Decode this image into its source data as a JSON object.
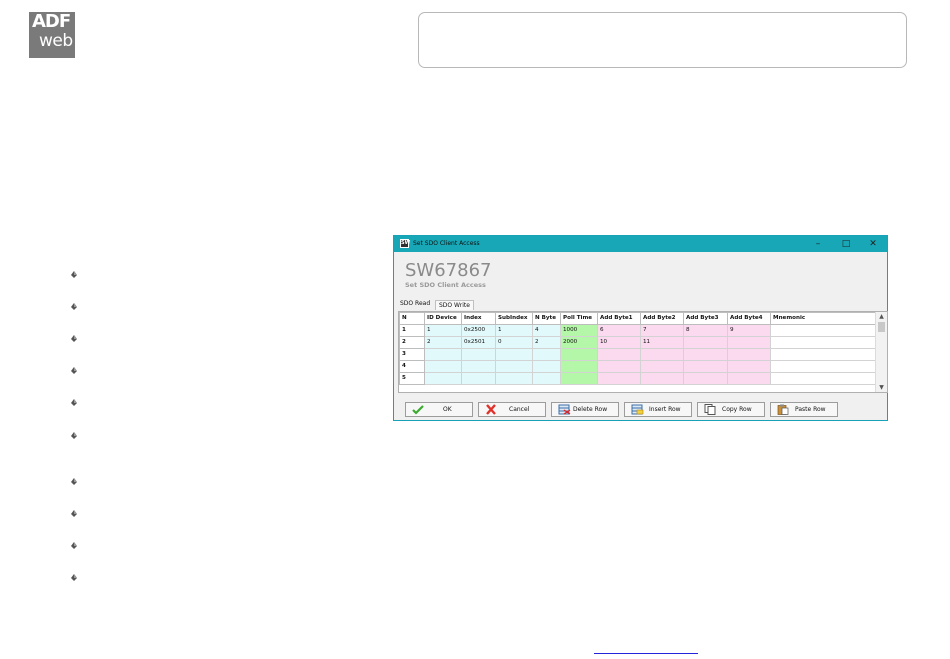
{
  "logo": {
    "line1": "ADF",
    "line2": "web"
  },
  "dialog": {
    "window_title": "Set SDO Client Access",
    "app_icon_text": "SW",
    "window_buttons": {
      "minimize": "–",
      "maximize": "□",
      "close": "✕"
    },
    "big_title": "SW67867",
    "subtitle": "Set SDO Client Access",
    "tabs": [
      {
        "label": "SDO Read",
        "active": true
      },
      {
        "label": "SDO Write",
        "active": false
      }
    ],
    "grid": {
      "columns": [
        "N",
        "ID Device",
        "Index",
        "SubIndex",
        "N Byte",
        "Poll Time",
        "Add Byte1",
        "Add Byte2",
        "Add Byte3",
        "Add Byte4",
        "Mnemonic"
      ],
      "rows": [
        [
          "1",
          "1",
          "0x2500",
          "1",
          "4",
          "1000",
          "6",
          "7",
          "8",
          "9",
          ""
        ],
        [
          "2",
          "2",
          "0x2501",
          "0",
          "2",
          "2000",
          "10",
          "11",
          "",
          "",
          ""
        ],
        [
          "3",
          "",
          "",
          "",
          "",
          "",
          "",
          "",
          "",
          "",
          ""
        ],
        [
          "4",
          "",
          "",
          "",
          "",
          "",
          "",
          "",
          "",
          "",
          ""
        ],
        [
          "5",
          "",
          "",
          "",
          "",
          "",
          "",
          "",
          "",
          "",
          ""
        ]
      ],
      "scroll_up": "▲",
      "scroll_down": "▼"
    },
    "buttons": {
      "ok": "OK",
      "cancel": "Cancel",
      "delete_row": "Delete Row",
      "insert_row": "Insert Row",
      "copy_row": "Copy Row",
      "paste_row": "Paste Row"
    }
  },
  "colors": {
    "titlebar": "#17a7b7",
    "cyan_cells": "#e2f9fb",
    "green_cells": "#b4f7a8",
    "pink_cells": "#fbd9ef",
    "link": "#2323d9"
  }
}
